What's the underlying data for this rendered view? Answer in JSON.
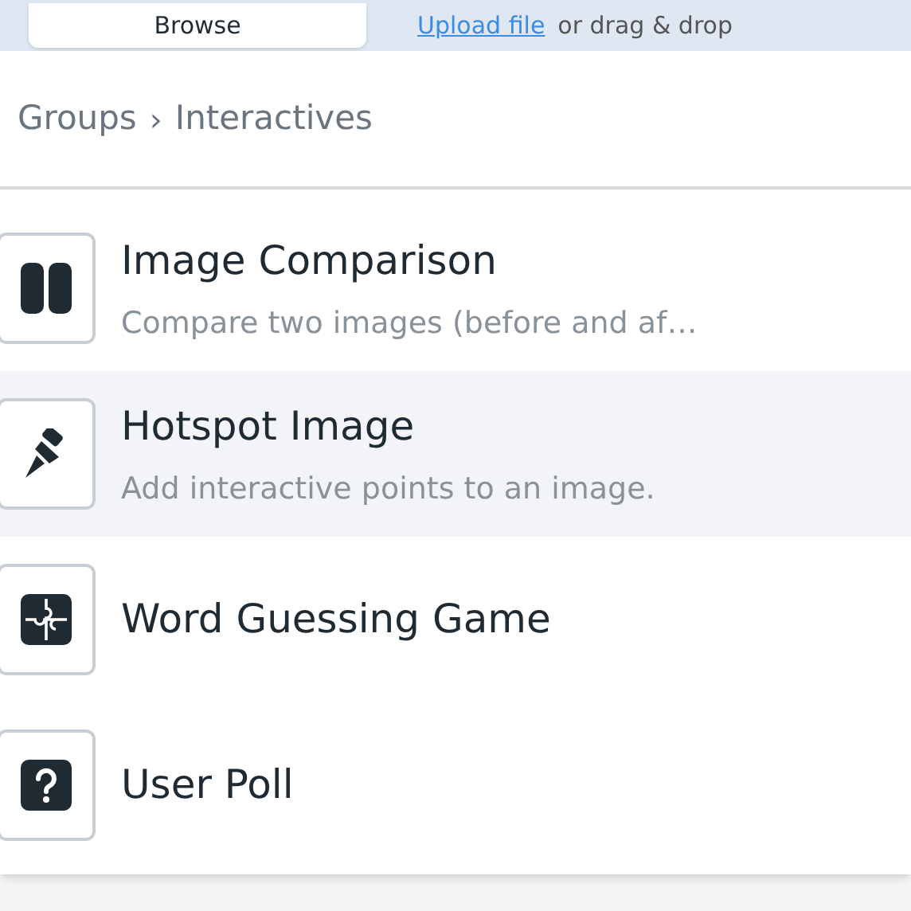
{
  "upload_bar": {
    "browse_button": "Browse",
    "upload_link": "Upload file",
    "hint": "or drag & drop"
  },
  "breadcrumb": {
    "items": [
      "Groups",
      "Interactives"
    ],
    "separator": "›"
  },
  "items": [
    {
      "title": "Image Comparison",
      "description": "Compare two images (before and af…",
      "selected": false
    },
    {
      "title": "Hotspot Image",
      "description": "Add interactive points to an image.",
      "selected": true
    },
    {
      "title": "Word Guessing Game",
      "selected": false
    },
    {
      "title": "User Poll",
      "selected": false
    }
  ]
}
